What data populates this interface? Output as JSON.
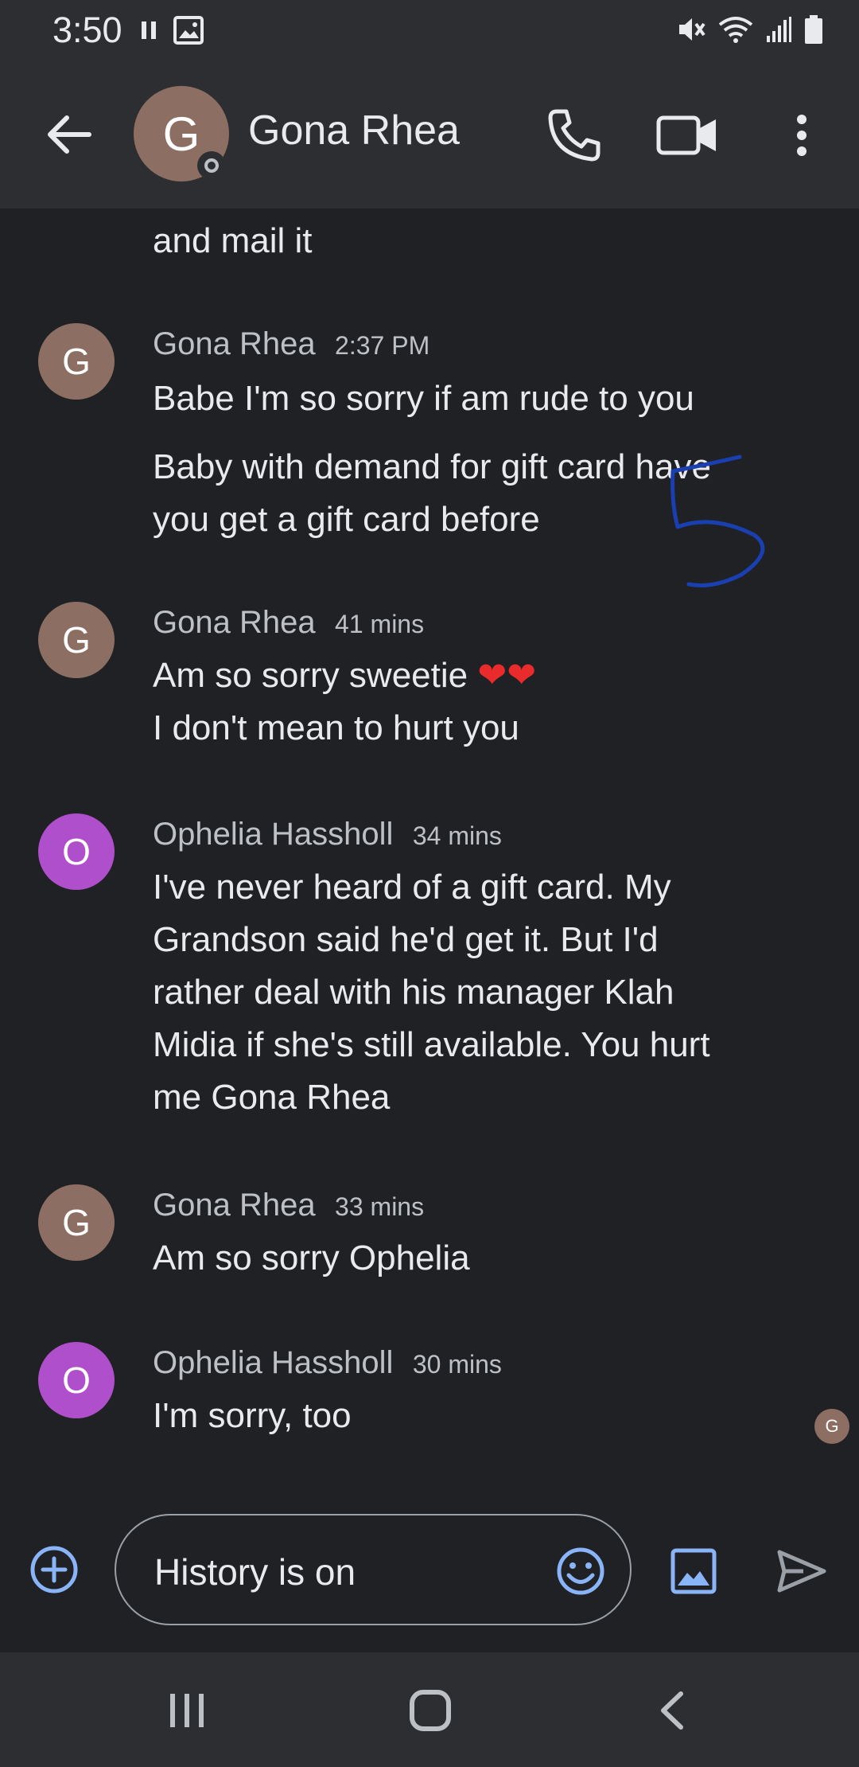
{
  "status_bar": {
    "time": "3:50"
  },
  "header": {
    "avatar_letter": "G",
    "contact_name": "Gona Rhea"
  },
  "messages": {
    "partial_text": "and mail it",
    "groups": [
      {
        "avatar": "G",
        "sender": "Gona Rhea",
        "time": "2:37 PM",
        "lines": [
          "Babe I'm so sorry if am rude to you",
          "Baby with demand for gift card have",
          "you get a gift card before"
        ]
      },
      {
        "avatar": "G",
        "sender": "Gona Rhea",
        "time": "41 mins",
        "lines": [
          "Am so sorry sweetie",
          "I don't mean to hurt you"
        ],
        "emoji": "❤❤"
      },
      {
        "avatar": "O",
        "sender": "Ophelia Hassholl",
        "time": "34 mins",
        "lines": [
          "I've never heard of a gift card. My",
          "Grandson said he'd get it. But I'd",
          "rather deal with his manager Klah",
          "Midia if she's still available. You hurt",
          "me Gona Rhea"
        ]
      },
      {
        "avatar": "G",
        "sender": "Gona Rhea",
        "time": "33 mins",
        "lines": [
          "Am so sorry Ophelia"
        ]
      },
      {
        "avatar": "O",
        "sender": "Ophelia Hassholl",
        "time": "30 mins",
        "lines": [
          "I'm sorry, too"
        ]
      }
    ],
    "read_receipt_letter": "G"
  },
  "compose": {
    "placeholder": "History is on"
  },
  "colors": {
    "avatar_g": "#8d6e63",
    "avatar_o": "#b04fcb",
    "accent": "#8ab4f8",
    "background": "#202124",
    "bar": "#2d2e31"
  },
  "icons": [
    "back-arrow-icon",
    "phone-icon",
    "video-icon",
    "more-vert-icon",
    "add-icon",
    "emoji-icon",
    "image-icon",
    "send-icon"
  ]
}
